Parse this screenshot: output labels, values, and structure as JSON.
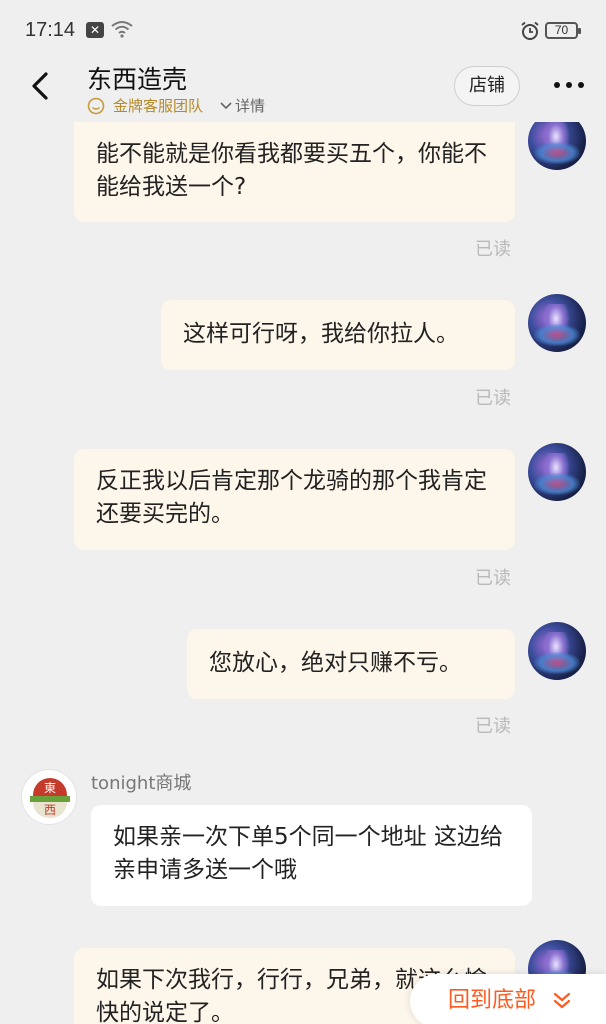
{
  "status_bar": {
    "time": "17:14",
    "battery": "70"
  },
  "header": {
    "title": "东西造壳",
    "team_label": "金牌客服团队",
    "detail_label": "详情",
    "store_button": "店铺"
  },
  "messages": [
    {
      "side": "right",
      "text": "能不能就是你看我都要买五个，你能不能给我送一个?",
      "status": "已读"
    },
    {
      "side": "right",
      "text": "这样可行呀，我给你拉人。",
      "status": "已读"
    },
    {
      "side": "right",
      "text": "反正我以后肯定那个龙骑的那个我肯定还要买完的。",
      "status": "已读"
    },
    {
      "side": "right",
      "text": "您放心，绝对只赚不亏。",
      "status": "已读"
    },
    {
      "side": "left",
      "sender": "tonight商城",
      "text": "如果亲一次下单5个同一个地址 这边给亲申请多送一个哦"
    },
    {
      "side": "right",
      "text": "如果下次我行，行行，兄弟，就这么愉快的说定了。"
    }
  ],
  "avatar_logo": {
    "top": "東",
    "bottom": "西"
  },
  "back_to_bottom": "回到底部",
  "colors": {
    "accent": "#ff5a1f",
    "gold": "#b48a2b",
    "bubble_mine": "#fdf6ea",
    "bubble_theirs": "#ffffff",
    "read": "#b9b9b9"
  }
}
